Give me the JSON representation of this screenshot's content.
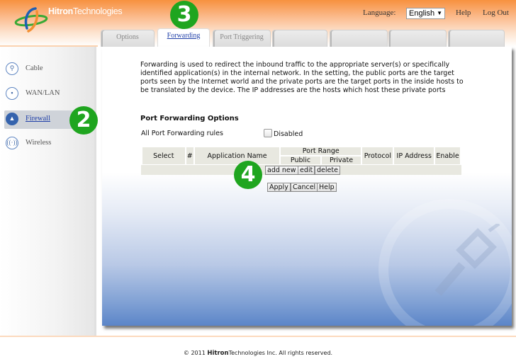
{
  "header": {
    "brand_bold": "Hitron",
    "brand_rest": "Technologies",
    "language_label": "Language:",
    "language_value": "English",
    "help_link": "Help",
    "logout_link": "Log Out"
  },
  "tabs": [
    {
      "label": "Options",
      "active": false
    },
    {
      "label": "Forwarding",
      "active": true
    },
    {
      "label": "Port Triggering",
      "active": false
    },
    {
      "label": "",
      "active": false
    },
    {
      "label": "",
      "active": false
    },
    {
      "label": "",
      "active": false
    },
    {
      "label": "",
      "active": false
    }
  ],
  "sidebar": {
    "items": [
      {
        "label": "Cable",
        "icon": "wrench-icon",
        "active": false
      },
      {
        "label": "WAN/LAN",
        "icon": "network-icon",
        "active": false
      },
      {
        "label": "Firewall",
        "icon": "firewall-icon",
        "active": true
      },
      {
        "label": "Wireless",
        "icon": "wireless-icon",
        "active": false
      }
    ]
  },
  "content": {
    "description": "Forwarding is used to redirect the inbound traffic to the appropriate server(s) or specifically identified application(s) in the internal network. In the setting, the public ports are the target ports seen by the Internet world and the private ports are the target ports in the inside hosts to be translated by the device. The IP addresses are the hosts which host these private ports",
    "section_title": "Port Forwarding Options",
    "all_rules_label": "All Port Forwarding rules",
    "disabled_label": "Disabled",
    "disabled_checked": false,
    "table": {
      "headers": {
        "select": "Select",
        "number": "#",
        "app_name": "Application Name",
        "port_range": "Port Range",
        "public": "Public",
        "private": "Private",
        "protocol": "Protocol",
        "ip_address": "IP Address",
        "enable": "Enable"
      },
      "rows": []
    },
    "buttons": {
      "add_new": "add new",
      "edit": "edit",
      "delete": "delete",
      "apply": "Apply",
      "cancel": "Cancel",
      "help": "Help"
    }
  },
  "markers": {
    "step2": "2",
    "step3": "3",
    "step4": "4"
  },
  "footer": {
    "prefix": "© 2011",
    "brand_bold": "Hitron",
    "brand_rest": "Technologies",
    "suffix": "Inc.  All rights reserved."
  },
  "colors": {
    "header_orange": "#f7913f",
    "marker_green": "#1fa51f",
    "link_blue": "#1f3fa8"
  }
}
